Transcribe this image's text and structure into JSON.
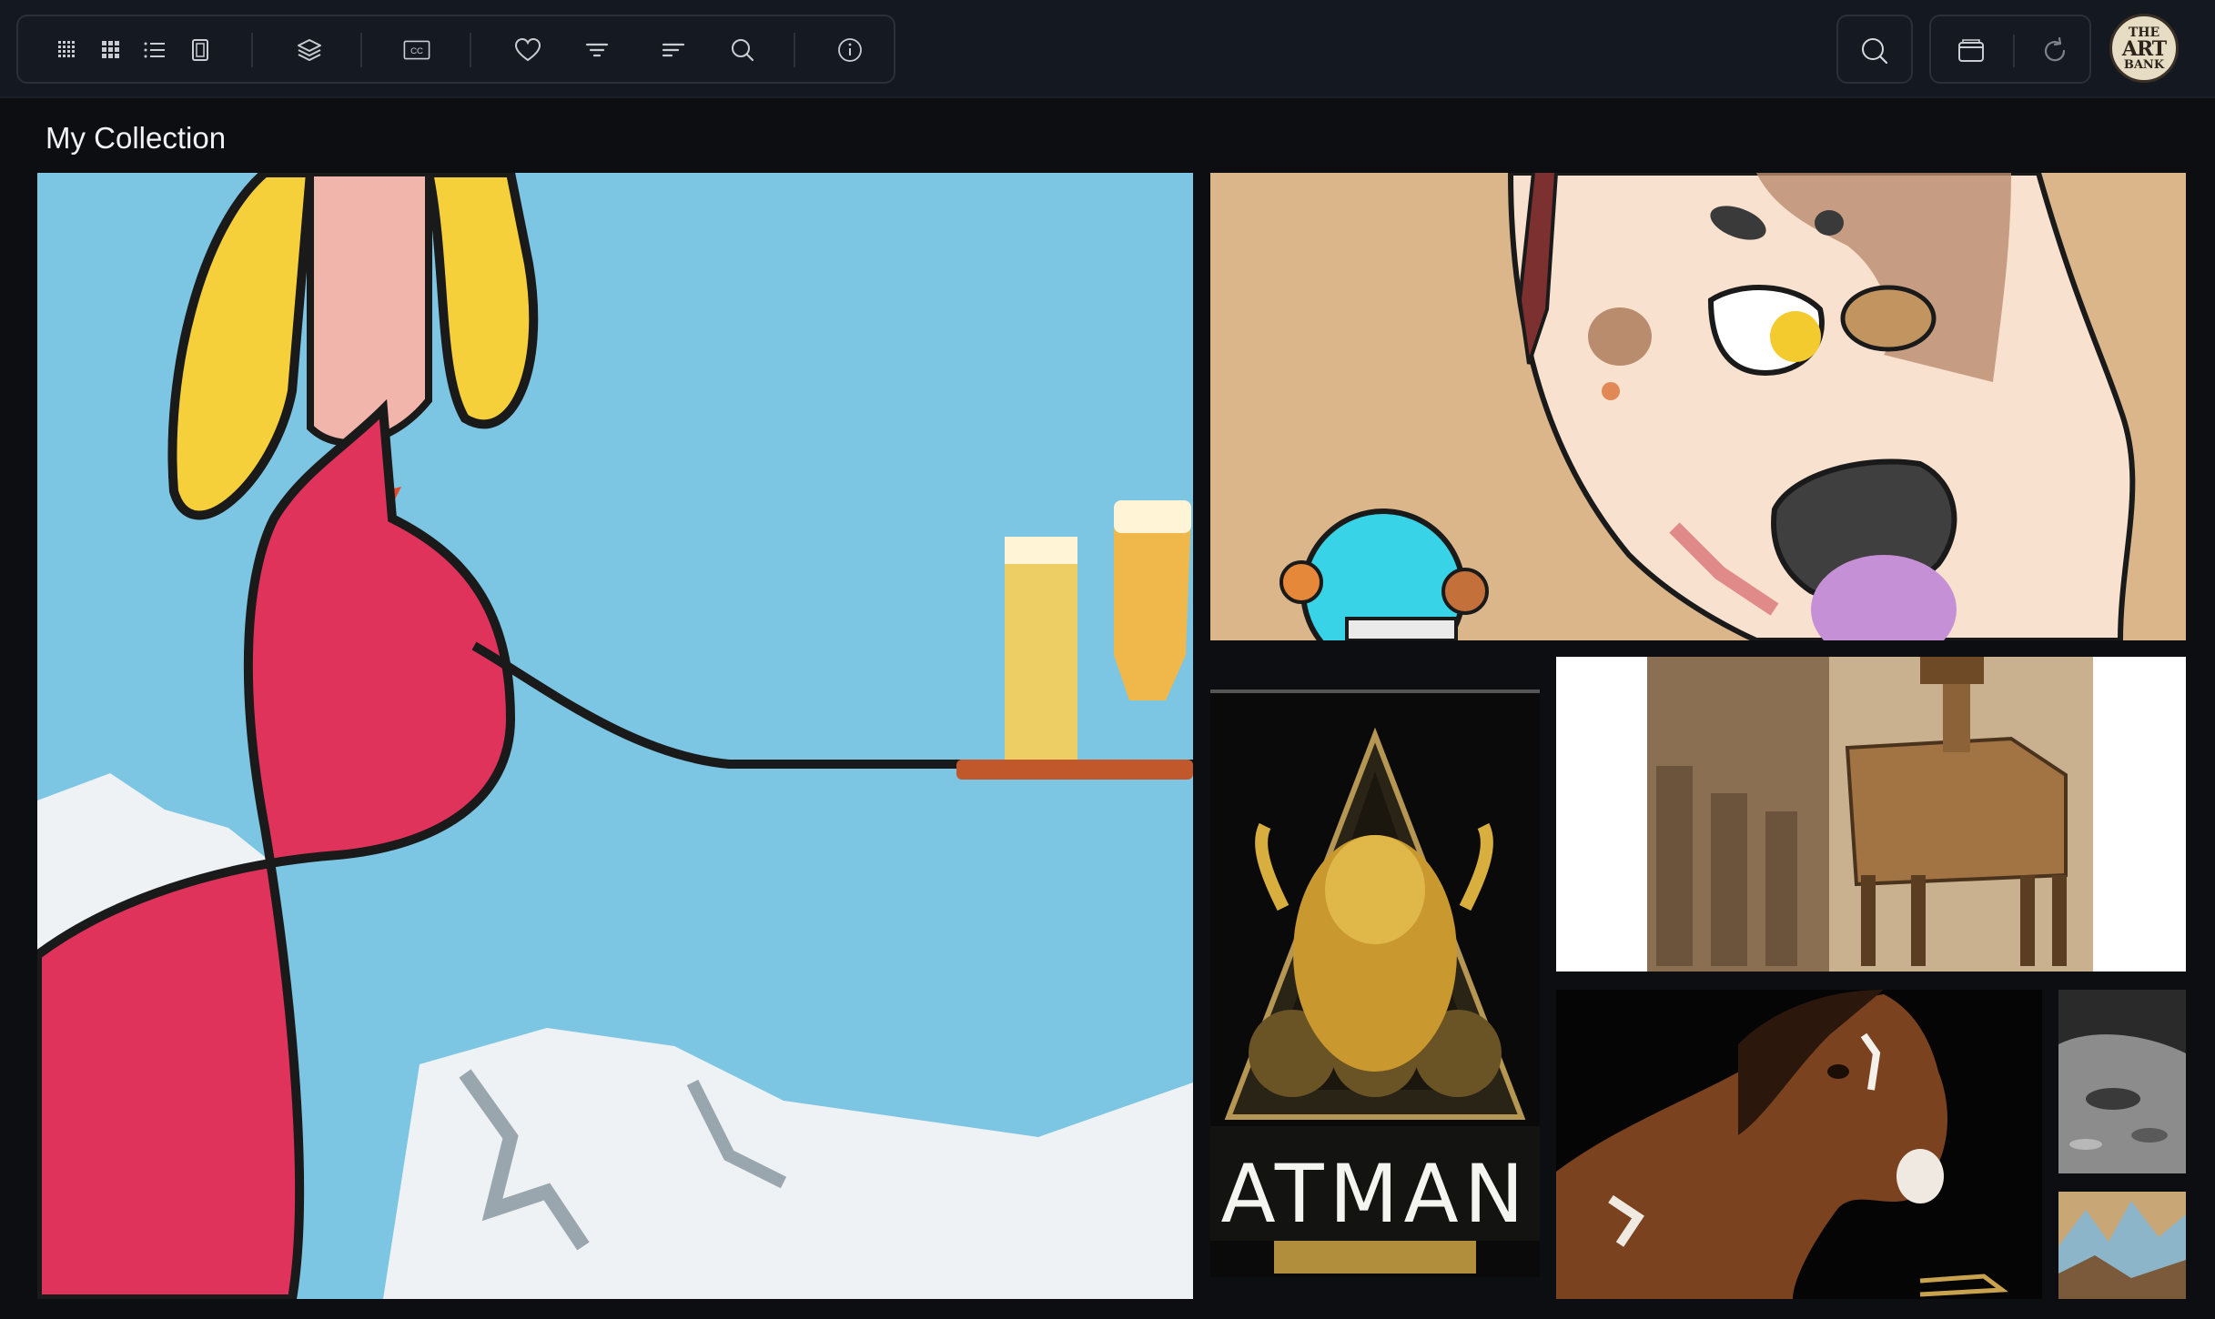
{
  "toolbar": {
    "left_icons": [
      "dense-grid-icon",
      "grid-icon",
      "list-icon",
      "single-view-icon",
      "layers-icon",
      "cc-icon",
      "heart-icon",
      "filter-icon",
      "sort-icon",
      "search-icon",
      "info-icon"
    ],
    "cc_label": "CC"
  },
  "right_actions": {
    "icons": [
      "search-icon",
      "wallet-icon",
      "refresh-icon"
    ]
  },
  "avatar": {
    "line1": "THE",
    "line2": "ART",
    "line3": "BANK"
  },
  "collection": {
    "title": "My Collection",
    "items": [
      {
        "subject": "woman-with-beer-tray"
      },
      {
        "subject": "cartoon-dog"
      },
      {
        "subject": "golden-deity"
      },
      {
        "subject": "wooden-horse"
      },
      {
        "subject": "brown-horse"
      },
      {
        "subject": "moon-surface"
      },
      {
        "subject": "mountain-painting"
      }
    ],
    "atman_text": "ATMAN"
  },
  "colors": {
    "background": "#0c0e12",
    "topbar": "#141821",
    "border": "#2a2f39",
    "icon": "#c9ccd3"
  }
}
